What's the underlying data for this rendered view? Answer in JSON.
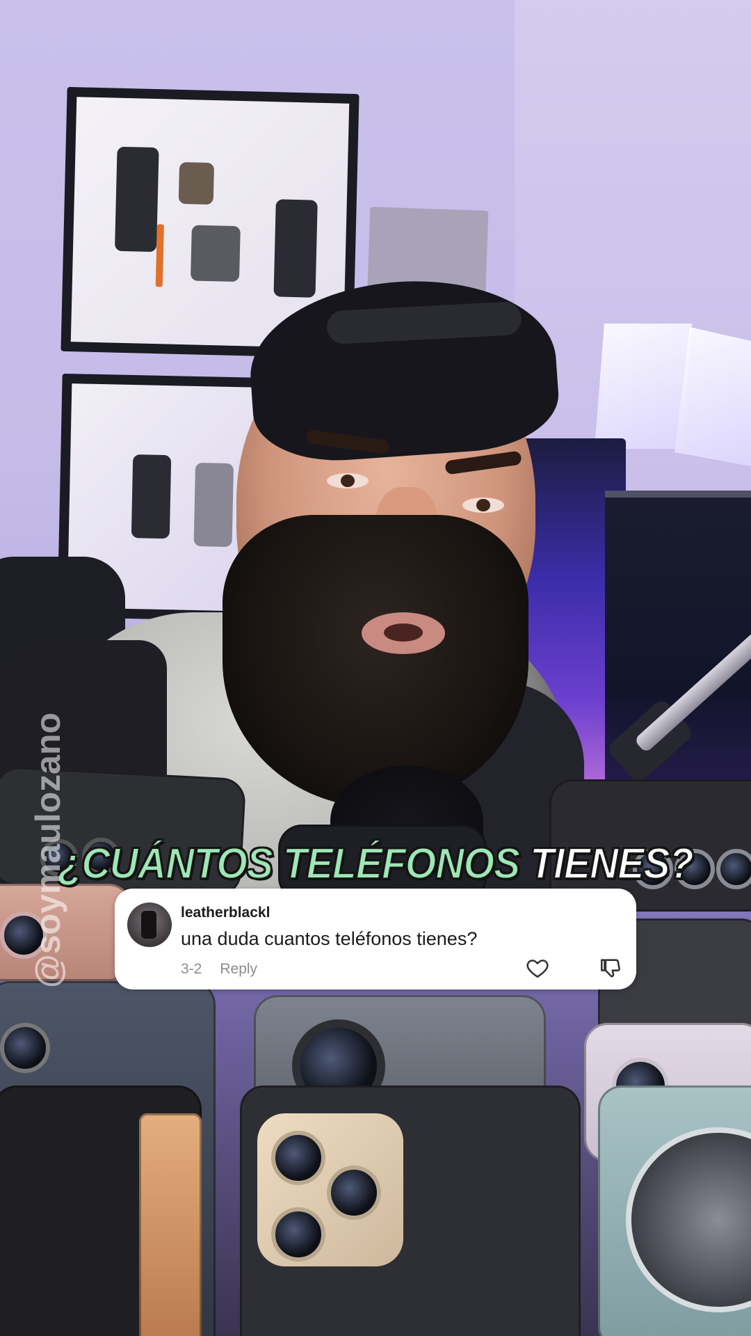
{
  "headline": {
    "part_green": "¿CUÁNTOS TELÉFONOS",
    "part_white": "TIENES?"
  },
  "comment": {
    "username": "leatherblackl",
    "text": "una duda cuantos teléfonos tienes?",
    "date": "3-2",
    "reply_label": "Reply",
    "like_icon": "heart-outline-icon",
    "dislike_icon": "thumbs-down-icon"
  },
  "watermark": "@soymaulozano",
  "colors": {
    "headline_green": "#9ee7b6",
    "headline_white": "#ffffff",
    "card_bg": "#ffffff",
    "meta_gray": "#8d8d8d"
  }
}
